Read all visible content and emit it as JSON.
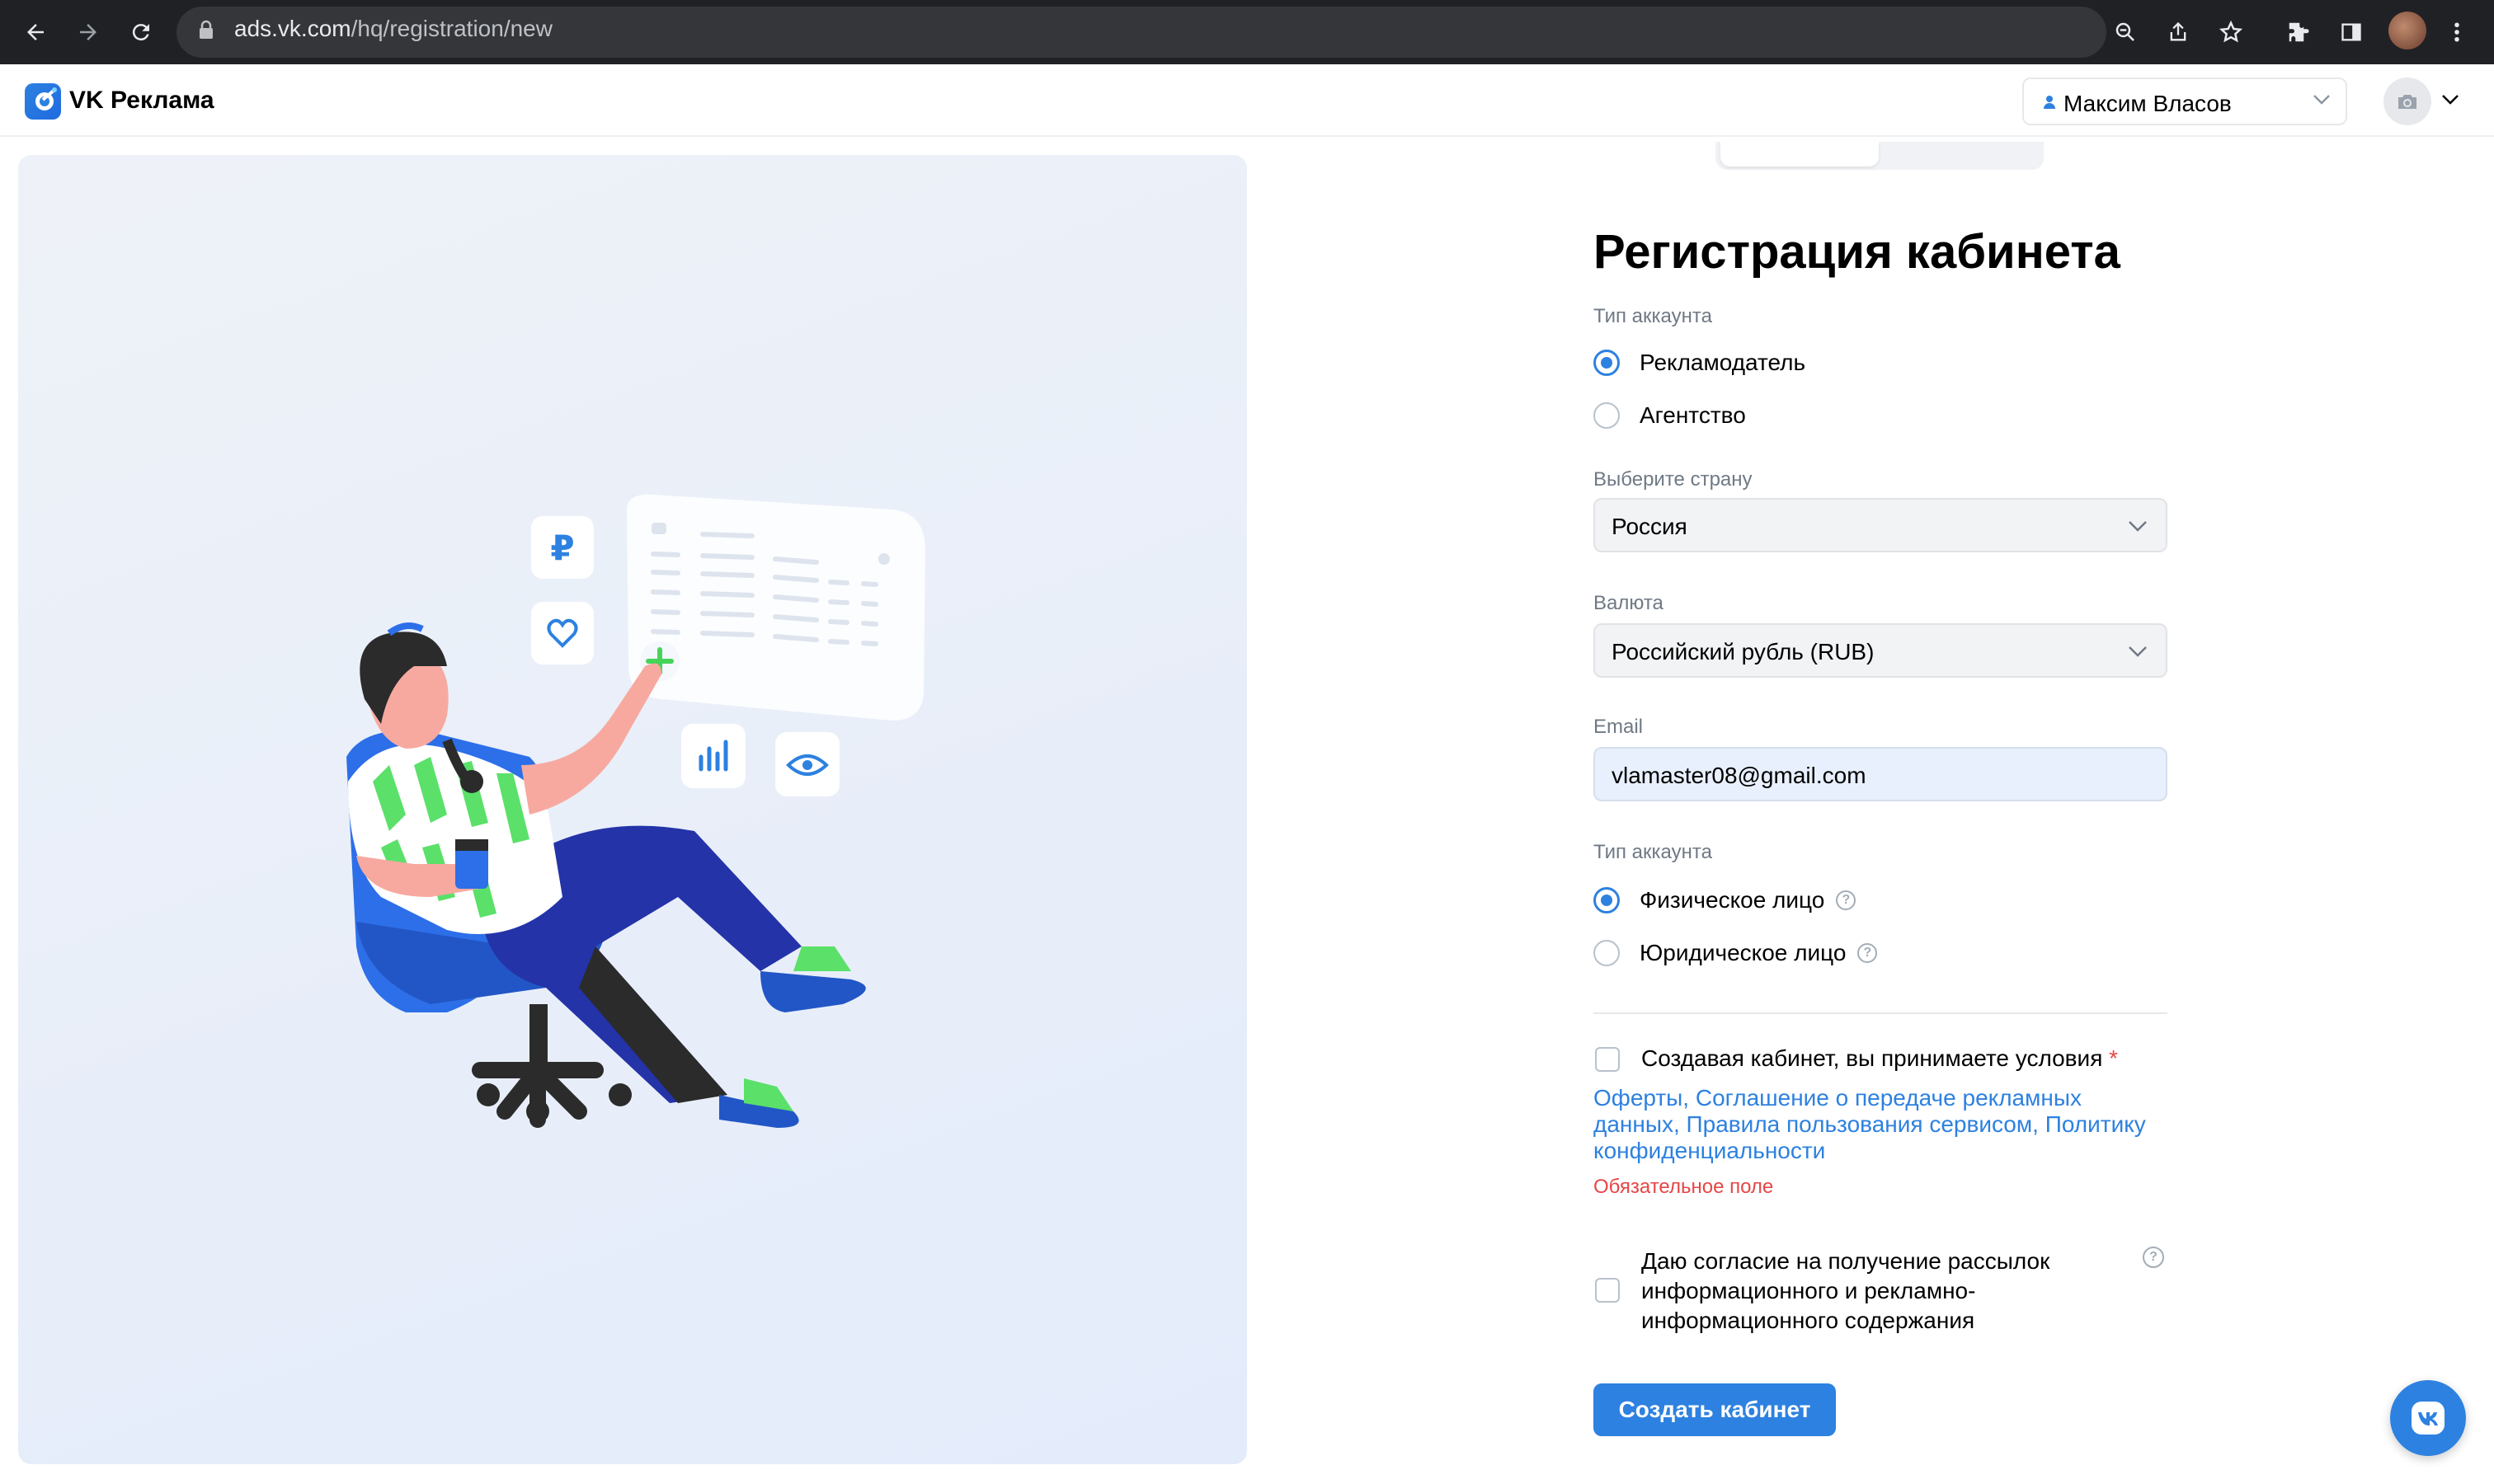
{
  "browser": {
    "url_host": "ads.vk.com",
    "url_path": "/hq/registration/new"
  },
  "app": {
    "logo_text": "VK Реклама",
    "user_name": "Максим Власов"
  },
  "form": {
    "title": "Регистрация кабинета",
    "account_type_label": "Тип аккаунта",
    "account_type_options": [
      {
        "label": "Рекламодатель",
        "selected": true
      },
      {
        "label": "Агентство",
        "selected": false
      }
    ],
    "country_label": "Выберите страну",
    "country_value": "Россия",
    "currency_label": "Валюта",
    "currency_value": "Российский рубль (RUB)",
    "email_label": "Email",
    "email_value": "vlamaster08@gmail.com",
    "person_type_label": "Тип аккаунта",
    "person_type_options": [
      {
        "label": "Физическое лицо",
        "selected": true
      },
      {
        "label": "Юридическое лицо",
        "selected": false
      }
    ],
    "terms_text": "Создавая кабинет, вы принимаете условия",
    "terms_required_mark": "*",
    "terms_links": [
      "Оферты",
      "Соглашение о передаче рекламных данных",
      "Правила пользования сервисом",
      "Политику конфиденциальности"
    ],
    "required_error": "Обязательное поле",
    "newsletter_text": "Даю согласие на получение рассылок информационного и рекламно-информационного содержания",
    "submit_label": "Создать кабинет"
  },
  "illustration": {
    "currency_symbol": "₽"
  },
  "colors": {
    "accent": "#2d81e0",
    "error": "#e64646",
    "browser_bar": "#202124"
  },
  "icons": [
    "back-icon",
    "forward-icon",
    "reload-icon",
    "lock-icon",
    "zoom-icon",
    "share-icon",
    "star-icon",
    "extensions-icon",
    "sidepanel-icon",
    "menu-icon",
    "user-icon",
    "camera-icon",
    "chevron-down-icon",
    "help-icon",
    "vk-icon"
  ]
}
